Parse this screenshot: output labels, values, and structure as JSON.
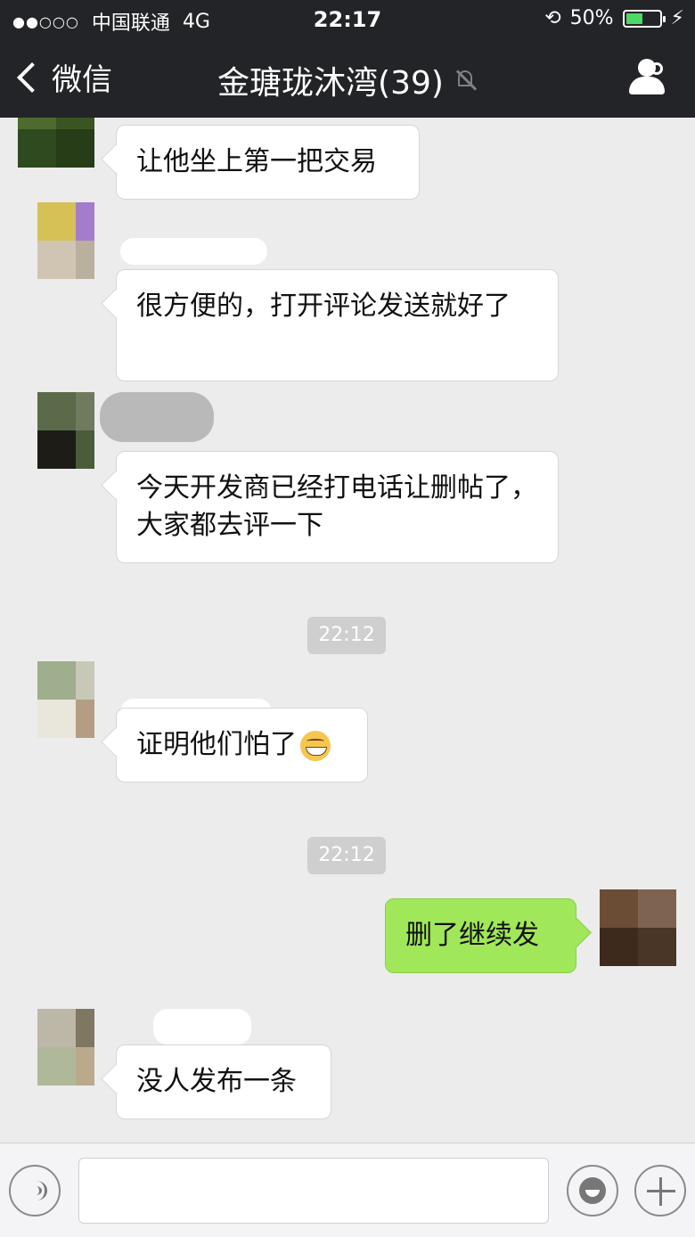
{
  "status_bar": {
    "signal_dots": "●●○○○",
    "carrier": "中国联通",
    "network": "4G",
    "time": "22:17",
    "battery_percent": "50%",
    "battery_level": 0.5
  },
  "nav": {
    "back_label": "微信",
    "title": "金瑭珑沐湾(39)",
    "muted": true
  },
  "messages": [
    {
      "side": "left",
      "text": "让他坐上第一把交易"
    },
    {
      "side": "left",
      "text": "很方便的，打开评论发送就好了"
    },
    {
      "side": "left",
      "text": "今天开发商已经打电话让删帖了，大家都去评一下"
    },
    {
      "type": "timestamp",
      "text": "22:12"
    },
    {
      "side": "left",
      "text": "证明他们怕了",
      "emoji": "grin-emoji"
    },
    {
      "type": "timestamp",
      "text": "22:12"
    },
    {
      "side": "right",
      "text": "删了继续发"
    },
    {
      "side": "left",
      "text": "没人发布一条"
    }
  ],
  "input_bar": {
    "voice_icon": "voice-icon",
    "emoji_icon": "emoji-icon",
    "plus_icon": "plus-icon",
    "text_value": ""
  },
  "colors": {
    "nav_bg": "#232428",
    "chat_bg": "#ececec",
    "own_bubble": "#a0e75a",
    "other_bubble": "#ffffff"
  }
}
